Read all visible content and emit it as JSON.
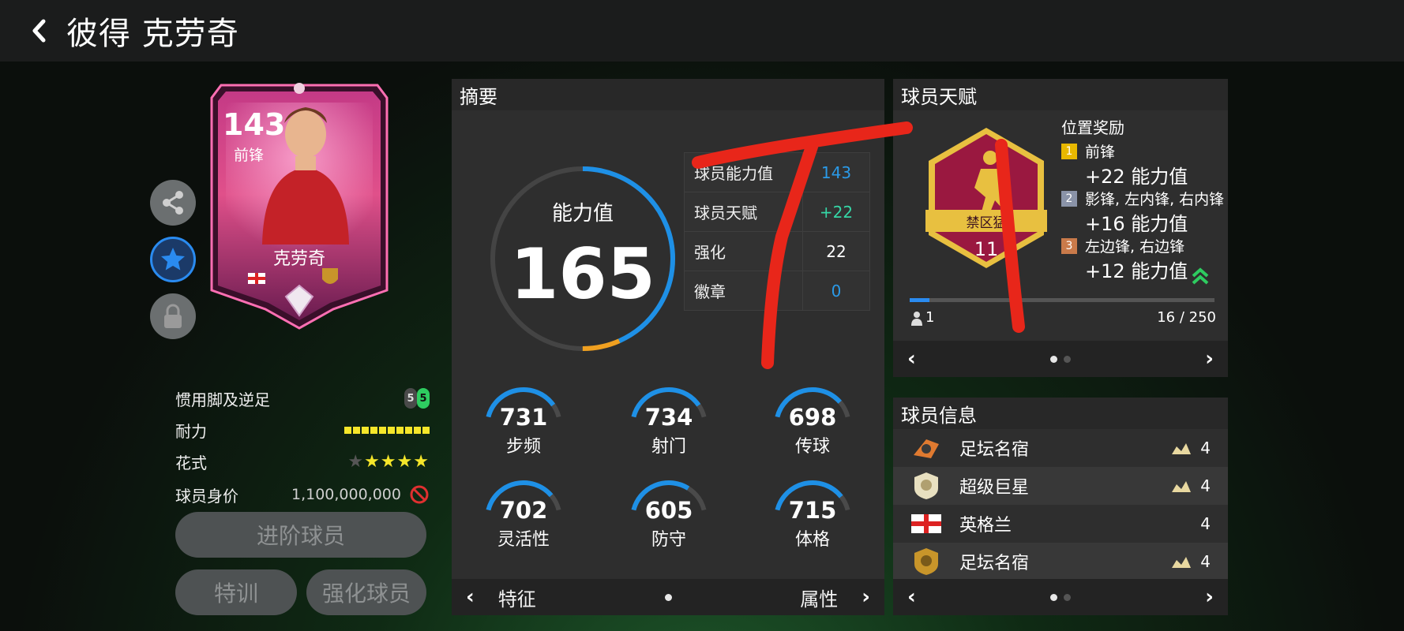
{
  "header": {
    "title": "彼得 克劳奇"
  },
  "card": {
    "rating": "143",
    "position": "前锋",
    "name": "克劳奇"
  },
  "attributes": {
    "foot_label": "惯用脚及逆足",
    "foot_left": "5",
    "foot_right": "5",
    "stamina_label": "耐力",
    "stamina_level": 10,
    "skill_label": "花式",
    "skill_stars": 4,
    "skill_max": 5,
    "value_label": "球员身价",
    "value": "1,100,000,000"
  },
  "buttons": {
    "advance": "进阶球员",
    "train": "特训",
    "enhance": "强化球员"
  },
  "summary": {
    "title": "摘要",
    "ovr_label": "能力值",
    "ovr_value": "165",
    "table": [
      {
        "label": "球员能力值",
        "value": "143",
        "color": "#2a9ae8"
      },
      {
        "label": "球员天赋",
        "value": "+22",
        "color": "#35d6a6"
      },
      {
        "label": "强化",
        "value": "22",
        "color": "#ffffff"
      },
      {
        "label": "徽章",
        "value": "0",
        "color": "#2a9ae8"
      }
    ],
    "stats": [
      {
        "value": "731",
        "label": "步频",
        "fill": 0.731
      },
      {
        "value": "734",
        "label": "射门",
        "fill": 0.734
      },
      {
        "value": "698",
        "label": "传球",
        "fill": 0.698
      },
      {
        "value": "702",
        "label": "灵活性",
        "fill": 0.702
      },
      {
        "value": "605",
        "label": "防守",
        "fill": 0.605
      },
      {
        "value": "715",
        "label": "体格",
        "fill": 0.715
      }
    ],
    "nav_left": "特征",
    "nav_right": "属性"
  },
  "talent": {
    "title": "球员天赋",
    "badge_name": "禁区猛",
    "badge_level": "11",
    "bonus_title": "位置奖励",
    "bonuses": [
      {
        "num": "1",
        "positions": "前锋",
        "value": "+22 能力值",
        "color": "#e8b800"
      },
      {
        "num": "2",
        "positions": "影锋, 左内锋, 右内锋",
        "value": "+16 能力值",
        "color": "#8a93a8"
      },
      {
        "num": "3",
        "positions": "左边锋, 右边锋",
        "value": "+12 能力值",
        "color": "#c97a4a"
      }
    ],
    "count": "1",
    "progress_text": "16 / 250",
    "progress": 0.064
  },
  "player_info": {
    "title": "球员信息",
    "items": [
      {
        "name": "足坛名宿",
        "count": "4"
      },
      {
        "name": "超级巨星",
        "count": "4"
      },
      {
        "name": "英格兰",
        "count": "4"
      },
      {
        "name": "足坛名宿",
        "count": "4"
      }
    ]
  },
  "colors": {
    "accent_blue": "#2a8bf0",
    "ring_blue": "#1e90e6",
    "ring_orange": "#f0a020",
    "annotation_red": "#e8261a"
  }
}
